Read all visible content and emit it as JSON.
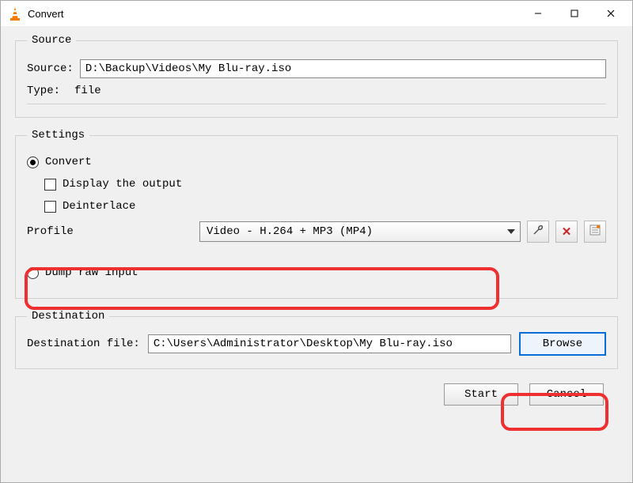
{
  "window": {
    "title": "Convert"
  },
  "source": {
    "legend": "Source",
    "source_label": "Source:",
    "source_value": "D:\\Backup\\Videos\\My Blu-ray.iso",
    "type_label": "Type:",
    "type_value": "file"
  },
  "settings": {
    "legend": "Settings",
    "convert_label": "Convert",
    "display_output_label": "Display the output",
    "deinterlace_label": "Deinterlace",
    "profile_label": "Profile",
    "profile_value": "Video - H.264 + MP3 (MP4)",
    "dump_label": "Dump raw input"
  },
  "destination": {
    "legend": "Destination",
    "file_label": "Destination file:",
    "file_value": "C:\\Users\\Administrator\\Desktop\\My Blu-ray.iso",
    "browse_label": "Browse"
  },
  "footer": {
    "start_label": "Start",
    "cancel_label": "Cancel"
  },
  "icons": {
    "wrench": "wrench-icon",
    "delete": "delete-icon",
    "list": "list-icon"
  }
}
